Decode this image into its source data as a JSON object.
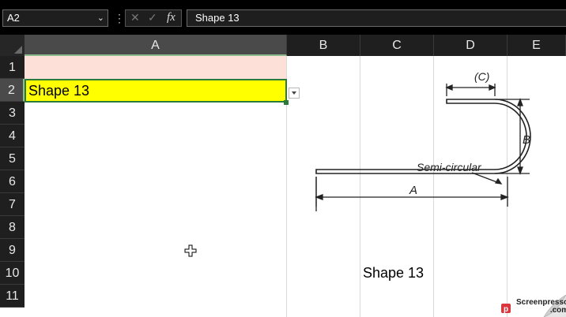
{
  "formula_bar": {
    "name_box": "A2",
    "chevron": "⌄",
    "more_icon": "⋮",
    "cancel_icon": "✕",
    "enter_icon": "✓",
    "fx_label": "fx",
    "formula": "Shape 13"
  },
  "columns": [
    "A",
    "B",
    "C",
    "D",
    "E"
  ],
  "rows": [
    "1",
    "2",
    "3",
    "4",
    "5",
    "6",
    "7",
    "8",
    "9",
    "10",
    "11"
  ],
  "cells": {
    "A1": "",
    "A2": "Shape 13",
    "caption": "Shape 13"
  },
  "diagram": {
    "label_c": "(C)",
    "label_b": "B",
    "label_a": "A",
    "label_curve": "Semi-circular"
  },
  "watermark": {
    "line1": "Screenpresso",
    "line2": ".com"
  },
  "colors": {
    "selected_fill": "#ffff00",
    "a1_fill": "#fde1d8",
    "selection_border": "#2a7a3a"
  },
  "icons": [
    "chevron-down-icon",
    "cancel-icon",
    "confirm-icon",
    "function-icon",
    "dropdown-arrow-icon",
    "move-cursor-icon"
  ]
}
